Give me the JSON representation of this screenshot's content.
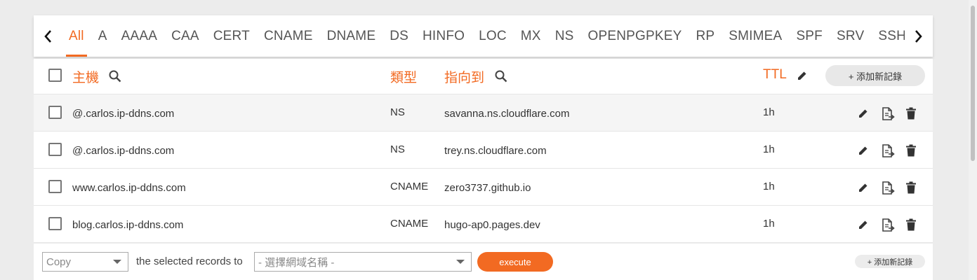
{
  "tabs": [
    "All",
    "A",
    "AAAA",
    "CAA",
    "CERT",
    "CNAME",
    "DNAME",
    "DS",
    "HINFO",
    "LOC",
    "MX",
    "NS",
    "OPENPGPKEY",
    "RP",
    "SMIMEA",
    "SPF",
    "SRV",
    "SSHFP"
  ],
  "active_tab": "All",
  "table": {
    "headers": {
      "host": "主機",
      "type": "類型",
      "points_to": "指向到",
      "ttl": "TTL",
      "add_button": "+ 添加新記錄"
    },
    "rows": [
      {
        "host": "@.carlos.ip-ddns.com",
        "type": "NS",
        "points_to": "savanna.ns.cloudflare.com",
        "ttl": "1h"
      },
      {
        "host": "@.carlos.ip-ddns.com",
        "type": "NS",
        "points_to": "trey.ns.cloudflare.com",
        "ttl": "1h"
      },
      {
        "host": "www.carlos.ip-ddns.com",
        "type": "CNAME",
        "points_to": "zero3737.github.io",
        "ttl": "1h"
      },
      {
        "host": "blog.carlos.ip-ddns.com",
        "type": "CNAME",
        "points_to": "hugo-ap0.pages.dev",
        "ttl": "1h"
      }
    ]
  },
  "footer": {
    "action_select": "Copy",
    "text": "the selected records to",
    "domain_select": "- 選擇網域名稱 -",
    "execute_label": "execute",
    "add_button": "+ 添加新記錄"
  },
  "colors": {
    "accent": "#f26a22"
  }
}
